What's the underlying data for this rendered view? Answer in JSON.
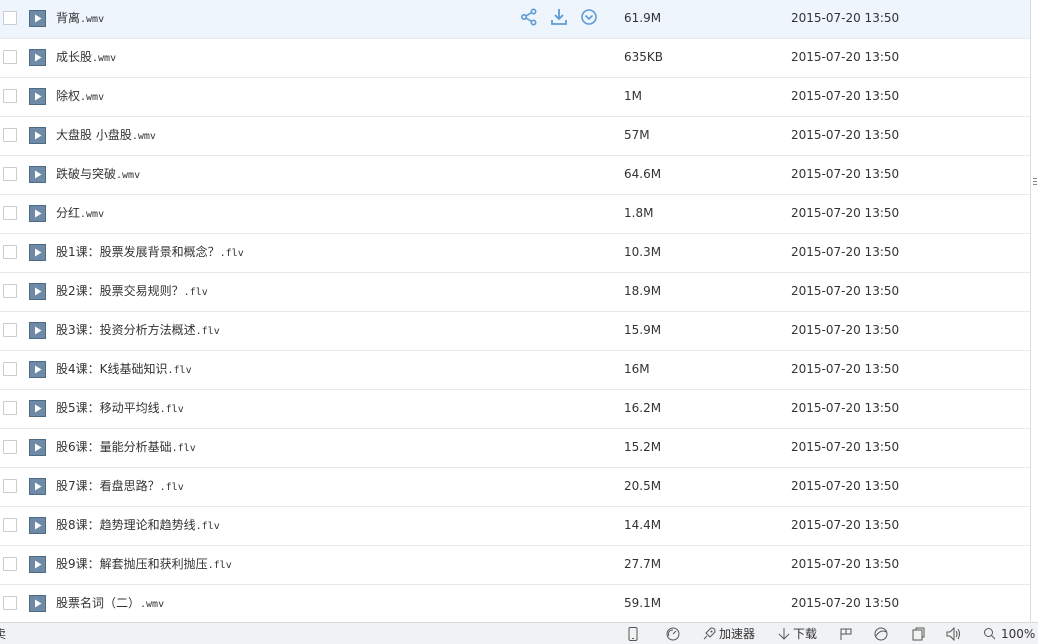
{
  "files": [
    {
      "name": "背离",
      "ext": ".wmv",
      "size": "61.9M",
      "date": "2015-07-20 13:50",
      "active": true
    },
    {
      "name": "成长股",
      "ext": ".wmv",
      "size": "635KB",
      "date": "2015-07-20 13:50"
    },
    {
      "name": "除权",
      "ext": ".wmv",
      "size": "1M",
      "date": "2015-07-20 13:50"
    },
    {
      "name": "大盘股 小盘股",
      "ext": ".wmv",
      "size": "57M",
      "date": "2015-07-20 13:50"
    },
    {
      "name": "跌破与突破",
      "ext": ".wmv",
      "size": "64.6M",
      "date": "2015-07-20 13:50"
    },
    {
      "name": "分红",
      "ext": ".wmv",
      "size": "1.8M",
      "date": "2015-07-20 13:50"
    },
    {
      "name": "股1课：股票发展背景和概念？",
      "ext": ".flv",
      "size": "10.3M",
      "date": "2015-07-20 13:50"
    },
    {
      "name": "股2课：股票交易规则？",
      "ext": ".flv",
      "size": "18.9M",
      "date": "2015-07-20 13:50"
    },
    {
      "name": "股3课：投资分析方法概述",
      "ext": ".flv",
      "size": "15.9M",
      "date": "2015-07-20 13:50"
    },
    {
      "name": "股4课：K线基础知识",
      "ext": ".flv",
      "size": "16M",
      "date": "2015-07-20 13:50"
    },
    {
      "name": "股5课：移动平均线",
      "ext": ".flv",
      "size": "16.2M",
      "date": "2015-07-20 13:50"
    },
    {
      "name": "股6课：量能分析基础",
      "ext": ".flv",
      "size": "15.2M",
      "date": "2015-07-20 13:50"
    },
    {
      "name": "股7课：看盘思路？",
      "ext": ".flv",
      "size": "20.5M",
      "date": "2015-07-20 13:50"
    },
    {
      "name": "股8课：趋势理论和趋势线",
      "ext": ".flv",
      "size": "14.4M",
      "date": "2015-07-20 13:50"
    },
    {
      "name": "股9课：解套抛压和获利抛压",
      "ext": ".flv",
      "size": "27.7M",
      "date": "2015-07-20 13:50"
    },
    {
      "name": "股票名词（二）",
      "ext": ".wmv",
      "size": "59.1M",
      "date": "2015-07-20 13:50"
    }
  ],
  "row_actions": [
    "share-icon",
    "download-icon",
    "more-icon"
  ],
  "status_bar": {
    "left_text": "卖",
    "accelerator_label": "加速器",
    "download_label": "下载",
    "zoom": "100%"
  },
  "colors": {
    "accent": "#5c9bd6",
    "active_row": "#eef5fd",
    "video_icon": "#6f8aa7"
  }
}
